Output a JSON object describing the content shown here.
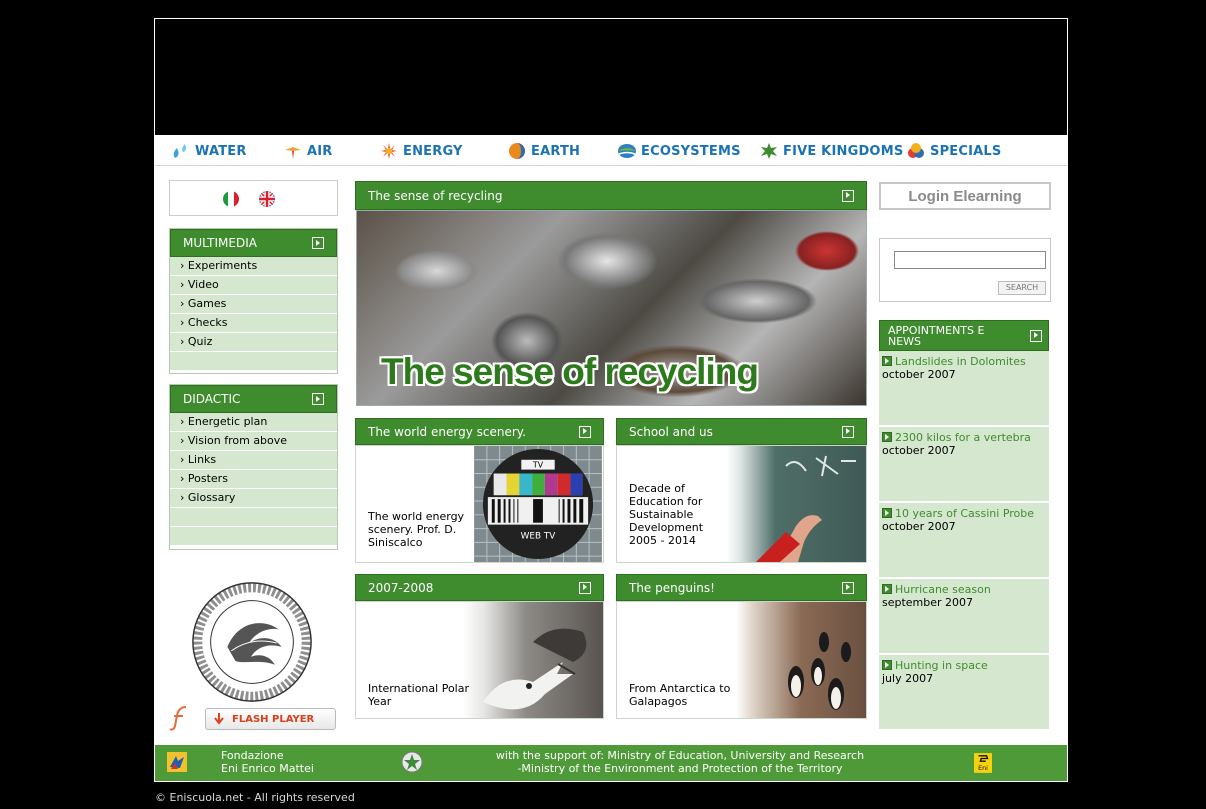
{
  "nav": {
    "items": [
      {
        "label": "WATER",
        "icon": "water-icon"
      },
      {
        "label": "AIR",
        "icon": "air-icon"
      },
      {
        "label": "ENERGY",
        "icon": "energy-icon"
      },
      {
        "label": "EARTH",
        "icon": "earth-icon"
      },
      {
        "label": "ECOSYSTEMS",
        "icon": "ecosystems-icon"
      },
      {
        "label": "FIVE KINGDOMS",
        "icon": "five-kingdoms-icon"
      },
      {
        "label": "SPECIALS",
        "icon": "specials-icon"
      }
    ],
    "color": "#1b73b3"
  },
  "languages": [
    "italian-flag-icon",
    "uk-flag-icon"
  ],
  "multimedia": {
    "title": "MULTIMEDIA",
    "items": [
      "› Experiments",
      "› Video",
      "› Games",
      "› Checks",
      "› Quiz"
    ]
  },
  "didactic": {
    "title": "DIDACTIC",
    "items": [
      "› Energetic plan",
      "› Vision from above",
      "› Links",
      "› Posters",
      "› Glossary"
    ]
  },
  "flash": {
    "label": "FLASH PLAYER"
  },
  "feature": {
    "title": "The sense of recycling",
    "overlay": "The sense of recycling"
  },
  "cards": [
    {
      "title": "The world energy scenery.",
      "text": "The world energy scenery. Prof. D. Siniscalco"
    },
    {
      "title": "School and us",
      "text": "Decade of Education for Sustainable Development 2005 - 2014"
    },
    {
      "title": "2007-2008",
      "text": "International Polar Year"
    },
    {
      "title": "The penguins!",
      "text": "From Antarctica to Galapagos"
    }
  ],
  "login": {
    "label": "Login Elearning"
  },
  "search": {
    "value": "",
    "button": "SEARCH"
  },
  "news": {
    "title": "APPOINTMENTS E NEWS",
    "items": [
      {
        "title": "Landslides in Dolomites",
        "date": "october 2007"
      },
      {
        "title": "2300 kilos for a vertebra",
        "date": "october 2007"
      },
      {
        "title": "10 years of Cassini Probe",
        "date": "october 2007"
      },
      {
        "title": "Hurricane season",
        "date": "september 2007"
      },
      {
        "title": "Hunting in space",
        "date": "july 2007"
      }
    ]
  },
  "footer": {
    "foundation_line1": "Fondazione",
    "foundation_line2": "Eni Enrico Mattei",
    "support_line1": "with the support of: Ministry of Education, University and Research",
    "support_line2": "-Ministry of the Environment and Protection of the Territory"
  },
  "copyright": "© Eniscuola.net - All rights reserved",
  "colors": {
    "green": "#3f8c2e",
    "light_green": "#d5e8cf",
    "blue": "#1b73b3"
  }
}
